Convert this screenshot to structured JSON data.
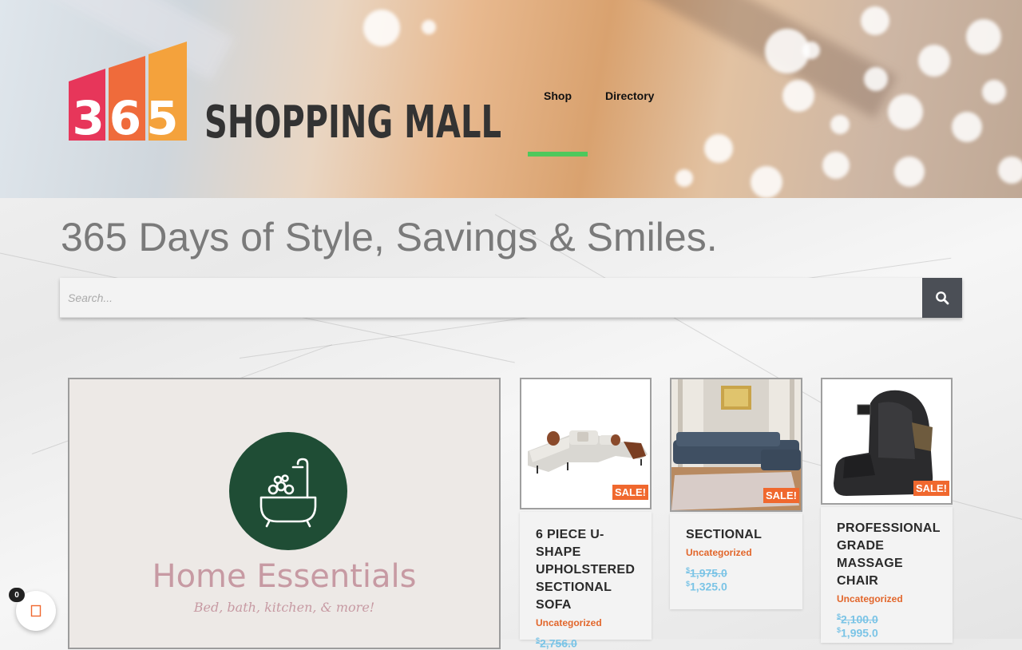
{
  "header": {
    "logo_number": "365",
    "logo_text": "SHOPPING MALL",
    "nav": [
      {
        "label": "Shop",
        "active": true
      },
      {
        "label": "Directory",
        "active": false
      }
    ]
  },
  "tagline": "365 Days of Style, Savings & Smiles.",
  "search": {
    "placeholder": "Search...",
    "value": ""
  },
  "banner": {
    "title": "Home Essentials",
    "subtitle": "Bed, bath, kitchen, & more!",
    "circle_color": "#1f4d35"
  },
  "products": [
    {
      "title": "6 PIECE U-SHAPE UPHOLSTERED SECTIONAL SOFA",
      "category": "Uncategorized",
      "badge": "SALE!",
      "currency": "$",
      "price_old": "2,756.0",
      "price_new": ""
    },
    {
      "title": "SECTIONAL",
      "category": "Uncategorized",
      "badge": "SALE!",
      "currency": "$",
      "price_old": "1,975.0",
      "price_new": "1,325.0"
    },
    {
      "title": "PROFESSIONAL GRADE MASSAGE CHAIR",
      "category": "Uncategorized",
      "badge": "SALE!",
      "currency": "$",
      "price_old": "2,100.0",
      "price_new": "1,995.0"
    }
  ],
  "cart": {
    "count": "0"
  },
  "colors": {
    "accent_nav": "#4ec85c",
    "sale_badge": "#f0682e",
    "category": "#e2662b",
    "price": "#7bc4e6",
    "search_button": "#4b4f56"
  }
}
